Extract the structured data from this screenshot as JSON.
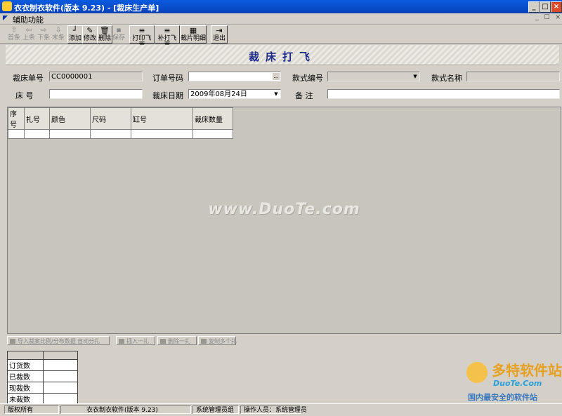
{
  "window": {
    "title": "衣衣制衣软件(版本 9.23)  - [裁床生产单]"
  },
  "menu": {
    "items": [
      "辅助功能"
    ]
  },
  "mdi_controls": [
    "_",
    "☐",
    "×"
  ],
  "toolbar": {
    "buttons": [
      {
        "label": "首条",
        "enabled": false,
        "icon": "up-arrow-icon"
      },
      {
        "label": "上条",
        "enabled": false,
        "icon": "left-arrow-icon"
      },
      {
        "label": "下条",
        "enabled": false,
        "icon": "right-arrow-icon"
      },
      {
        "label": "末条",
        "enabled": false,
        "icon": "down-arrow-icon"
      },
      {
        "label": "添加",
        "enabled": true,
        "icon": "add-icon"
      },
      {
        "label": "修改",
        "enabled": true,
        "icon": "edit-icon"
      },
      {
        "label": "删除",
        "enabled": true,
        "icon": "delete-icon"
      },
      {
        "label": "保存",
        "enabled": false,
        "icon": "save-icon"
      },
      {
        "label": "打印飞票",
        "enabled": true,
        "icon": "print-icon"
      },
      {
        "label": "补打飞票",
        "enabled": true,
        "icon": "reprint-icon"
      },
      {
        "label": "裁片明细",
        "enabled": true,
        "icon": "detail-icon"
      },
      {
        "label": "退出",
        "enabled": true,
        "icon": "exit-icon"
      }
    ]
  },
  "banner": {
    "title": "裁床打飞"
  },
  "form": {
    "cut_no_label": "裁床单号",
    "cut_no_value": "CC0000001",
    "order_no_label": "订单号码",
    "order_no_value": "",
    "style_no_label": "款式编号",
    "style_no_value": "",
    "style_name_label": "款式名称",
    "style_name_value": "",
    "bed_label": "床  号",
    "bed_value": "",
    "cut_date_label": "裁床日期",
    "cut_date_value": "2009年08月24日",
    "remark_label": "备  注",
    "remark_value": ""
  },
  "grid": {
    "columns": [
      "序号",
      "扎号",
      "颜色",
      "尺码",
      "缸号",
      "裁床数量"
    ],
    "rows": [
      [
        "",
        "",
        "",
        "",
        "",
        ""
      ]
    ]
  },
  "watermark": "www.DuoTe.com",
  "action_buttons": [
    "导入裁案比例/分布数据 自动分扎",
    "插入一扎",
    "删除一扎",
    "复制多个扎"
  ],
  "summary": {
    "rows": [
      {
        "label": "",
        "value": ""
      },
      {
        "label": "订货数",
        "value": ""
      },
      {
        "label": "已裁数",
        "value": ""
      },
      {
        "label": "现裁数",
        "value": ""
      },
      {
        "label": "未裁数",
        "value": ""
      }
    ]
  },
  "status": {
    "copyright": "版权所有",
    "app": "衣衣制衣软件(版本 9.23)",
    "group": "系统管理员组",
    "operator": "操作人员：系统管理员"
  },
  "corner_logo": {
    "name": "多特软件站",
    "url": "DuoTe.Com",
    "slogan": "国内最安全的软件站"
  }
}
